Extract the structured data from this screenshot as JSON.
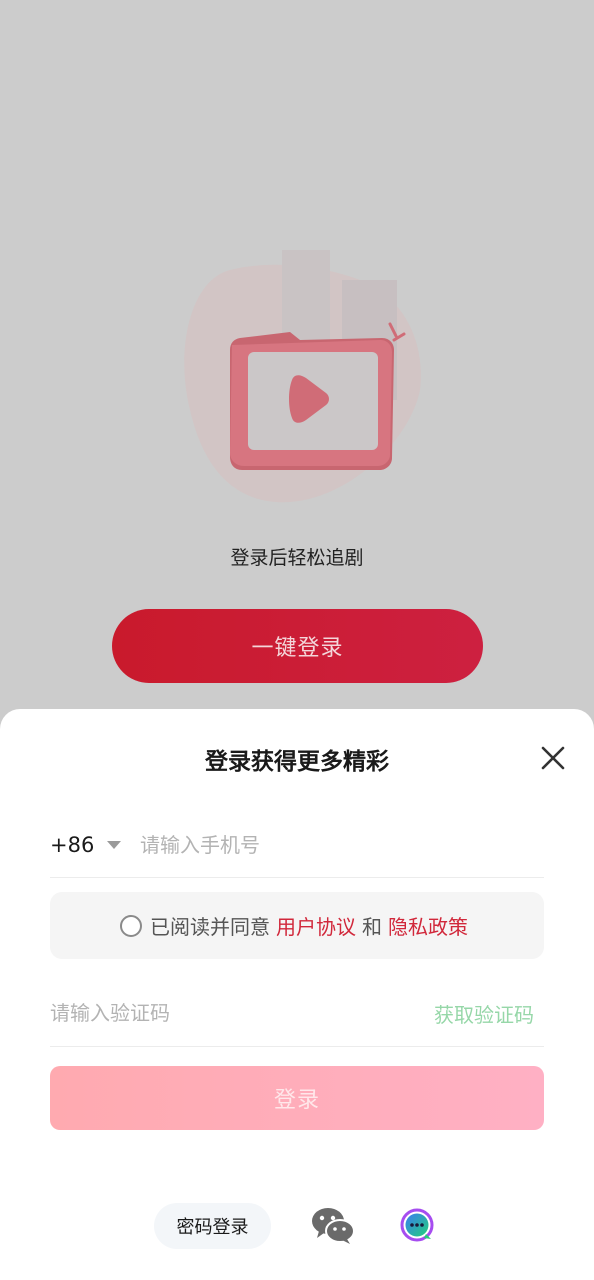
{
  "background": {
    "tagline": "登录后轻松追剧",
    "oneclick_label": "一键登录"
  },
  "sheet": {
    "title": "登录获得更多精彩",
    "country_code": "+86",
    "phone_placeholder": "请输入手机号",
    "agreement": {
      "prefix": "已阅读并同意",
      "user_agreement": "用户协议",
      "and": "和",
      "privacy_policy": "隐私政策"
    },
    "code_placeholder": "请输入验证码",
    "get_code_label": "获取验证码",
    "login_label": "登录",
    "alt_login": {
      "password_label": "密码登录",
      "wechat_icon": "wechat-icon",
      "chat_icon": "chat-bubble-icon"
    }
  },
  "colors": {
    "accent_red": "#d1283b",
    "one_click_red": "#c91a2c",
    "login_pink": "#ffaab0",
    "get_code_green": "#96d7a8",
    "overlay_gray": "#cccccc"
  }
}
